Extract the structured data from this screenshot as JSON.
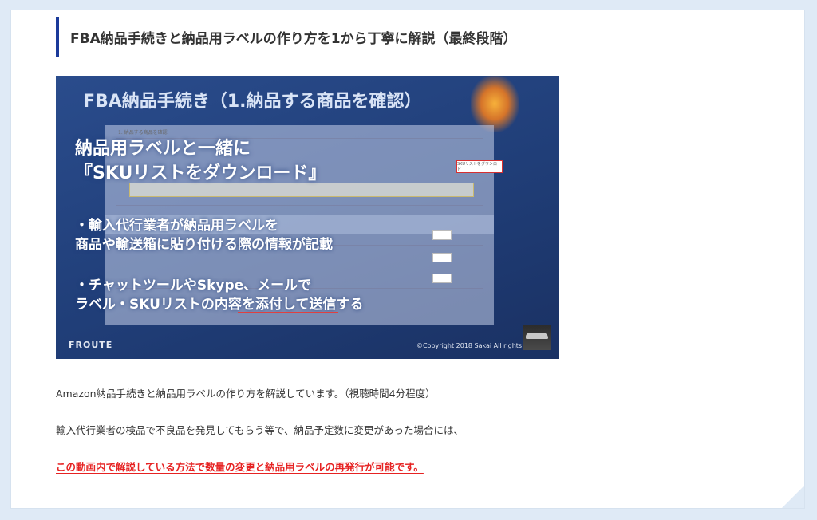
{
  "article": {
    "heading": "FBA納品手続きと納品用ラベルの作り方を1から丁寧に解説（最終段階）",
    "paragraphs": [
      "Amazon納品手続きと納品用ラベルの作り方を解説しています。（視聴時間4分程度）",
      "輸入代行業者の検品で不良品を発見してもらう等で、納品予定数に変更があった場合には、"
    ],
    "highlight": "この動画内で解説している方法で数量の変更と納品用ラベルの再発行が可能です。"
  },
  "video": {
    "title": "FBA納品手続き（1.納品する商品を確認）",
    "main_line1": "納品用ラベルと一緒に",
    "main_line2": "『SKUリストをダウンロード』",
    "bullet1_line1": "・輸入代行業者が納品用ラベルを",
    "bullet1_line2": "商品や輸送箱に貼り付ける際の情報が記載",
    "bullet2_line1": "・チャットツールやSkype、メールで",
    "bullet2_line2": "ラベル・SKUリストの内容を添付して送信する",
    "screen_title": "1. 納品する商品を確認",
    "screen_button": "SKUリストをダウンロード",
    "brand": "FROUTE",
    "copyright": "©Copyright 2018 Sakai All rights"
  },
  "colors": {
    "accent_bar": "#1b3a9a",
    "highlight_red": "#e62222"
  }
}
